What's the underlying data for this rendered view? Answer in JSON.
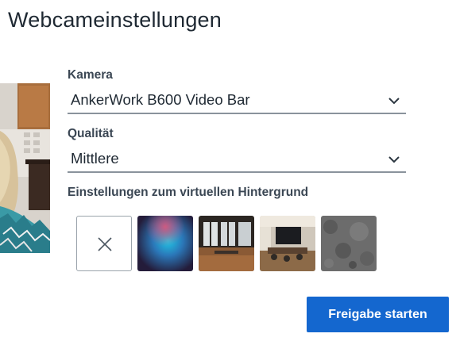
{
  "dialog": {
    "title": "Webcameinstellungen"
  },
  "camera": {
    "label": "Kamera",
    "value": "AnkerWork B600 Video Bar"
  },
  "quality": {
    "label": "Qualität",
    "value": "Mittlere"
  },
  "background": {
    "label": "Einstellungen zum virtuellen Hintergrund",
    "options": [
      {
        "name": "none",
        "icon": "close-icon"
      },
      {
        "name": "blur"
      },
      {
        "name": "office-window"
      },
      {
        "name": "conference-room"
      },
      {
        "name": "grey-texture"
      }
    ]
  },
  "actions": {
    "start_label": "Freigabe starten"
  },
  "colors": {
    "accent": "#1467cf",
    "underline": "#8a939c"
  }
}
